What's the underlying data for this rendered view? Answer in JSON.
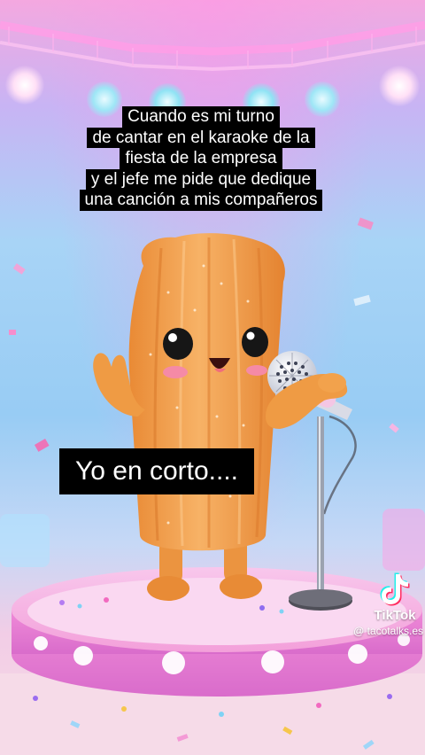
{
  "video": {
    "caption_top_lines": [
      "Cuando es mi turno",
      "de cantar en el karaoke de la",
      "fiesta de la empresa",
      "y el jefe me pide que dedique",
      "una canción a mis compañeros"
    ],
    "caption_bottom": "Yo en corto...."
  },
  "watermark": {
    "brand": "TikTok",
    "handle": "@ tacotalks.es",
    "logo_icon": "tiktok-logo-icon"
  },
  "scene": {
    "character": "churro-character",
    "props": [
      "microphone-icon",
      "mic-stand",
      "karaoke-stage",
      "stage-lights"
    ],
    "colors": {
      "caption_bg": "#000000",
      "caption_text": "#ffffff",
      "churro": "#f0a04a",
      "stage": "#f6a3dc"
    }
  }
}
